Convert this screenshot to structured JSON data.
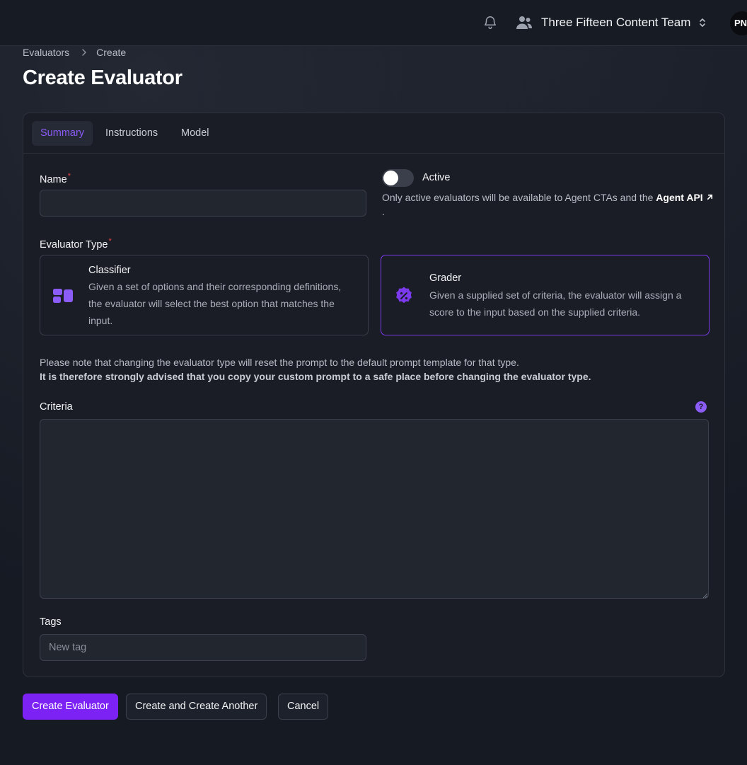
{
  "topbar": {
    "team_name": "Three Fifteen Content Team",
    "avatar_initials": "PN"
  },
  "breadcrumb": [
    "Evaluators",
    "Create"
  ],
  "page_title": "Create Evaluator",
  "tabs": [
    {
      "label": "Summary",
      "active": true
    },
    {
      "label": "Instructions",
      "active": false
    },
    {
      "label": "Model",
      "active": false
    }
  ],
  "form": {
    "name_label": "Name",
    "name_value": "",
    "active_label": "Active",
    "active_on": false,
    "active_help_prefix": "Only active evaluators will be available to Agent CTAs and the ",
    "active_help_link": "Agent API",
    "active_help_suffix": ".",
    "type_label": "Evaluator Type",
    "types": [
      {
        "title": "Classifier",
        "description": "Given a set of options and their corresponding definitions, the evaluator will select the best option that matches the input.",
        "selected": false,
        "icon": "classifier-icon"
      },
      {
        "title": "Grader",
        "description": "Given a supplied set of criteria, the evaluator will assign a score to the input based on the supplied criteria.",
        "selected": true,
        "icon": "grader-percent-icon"
      }
    ],
    "note_line1": "Please note that changing the evaluator type will reset the prompt to the default prompt template for that type.",
    "note_line2": "It is therefore strongly advised that you copy your custom prompt to a safe place before changing the evaluator type.",
    "criteria_label": "Criteria",
    "criteria_value": "",
    "tags_label": "Tags",
    "tags_placeholder": "New tag"
  },
  "actions": {
    "create": "Create Evaluator",
    "create_another": "Create and Create Another",
    "cancel": "Cancel"
  },
  "colors": {
    "accent": "#7c3aed",
    "primary_button": "#7c22f5",
    "required": "#ef4444"
  }
}
